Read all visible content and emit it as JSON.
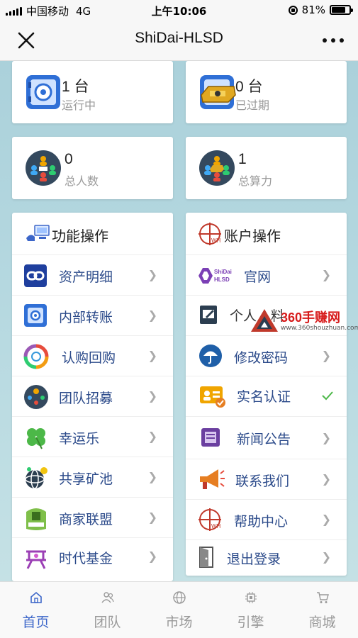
{
  "status_bar": {
    "carrier": "中国移动",
    "network": "4G",
    "time": "上午10:06",
    "battery": "81%",
    "battery_level": 0.81
  },
  "nav": {
    "title": "ShiDai-HLSD",
    "close_icon": "close-icon",
    "more_icon": "more-icon"
  },
  "stats": [
    {
      "value": "1 台",
      "label": "运行中",
      "icon": "safe-icon"
    },
    {
      "value": "0 台",
      "label": "已过期",
      "icon": "gold-bar-safe-icon"
    },
    {
      "value": "0",
      "label": "总人数",
      "icon": "team-people-icon"
    },
    {
      "value": "1",
      "label": "总算力",
      "icon": "computing-power-icon"
    }
  ],
  "functions": {
    "title": "功能操作",
    "icon": "function-ops-icon",
    "items": [
      {
        "label": "资产明细",
        "icon": "asset-detail-icon"
      },
      {
        "label": "内部转账",
        "icon": "internal-transfer-icon"
      },
      {
        "label": "认购回购",
        "icon": "subscribe-buyback-icon"
      },
      {
        "label": "团队招募",
        "icon": "team-recruit-icon"
      },
      {
        "label": "幸运乐",
        "icon": "clover-icon"
      },
      {
        "label": "共享矿池",
        "icon": "mining-pool-icon"
      },
      {
        "label": "商家联盟",
        "icon": "merchant-alliance-icon"
      },
      {
        "label": "时代基金",
        "icon": "fund-icon"
      }
    ]
  },
  "account": {
    "title": "账户操作",
    "icon": "account-ops-icon",
    "items": [
      {
        "label": "官网",
        "icon": "shidai-hlsd-logo-icon",
        "logo_text_1": "ShiDai",
        "logo_text_2": "HLSD"
      },
      {
        "label": "个人",
        "suffix": "料",
        "icon": "profile-edit-icon"
      },
      {
        "label": "修改密码",
        "icon": "umbrella-icon"
      },
      {
        "label": "实名认证",
        "icon": "id-card-icon",
        "verified": true
      },
      {
        "label": "新闻公告",
        "icon": "news-icon"
      },
      {
        "label": "联系我们",
        "icon": "megaphone-icon"
      },
      {
        "label": "帮助中心",
        "icon": "help-center-icon"
      },
      {
        "label": "退出登录",
        "icon": "logout-door-icon"
      }
    ]
  },
  "watermark": {
    "text": "360手赚网",
    "url": "www.360shouzhuan.com"
  },
  "tabs": [
    {
      "label": "首页",
      "icon": "home-icon",
      "active": true
    },
    {
      "label": "团队",
      "icon": "team-icon",
      "active": false
    },
    {
      "label": "市场",
      "icon": "globe-icon",
      "active": false
    },
    {
      "label": "引擎",
      "icon": "engine-chip-icon",
      "active": false
    },
    {
      "label": "商城",
      "icon": "cart-icon",
      "active": false
    }
  ],
  "colors": {
    "accent": "#3c66c9",
    "label_blue": "#2b4a8a",
    "verified_green": "#4cb848",
    "watermark_red": "#d71b1b"
  }
}
